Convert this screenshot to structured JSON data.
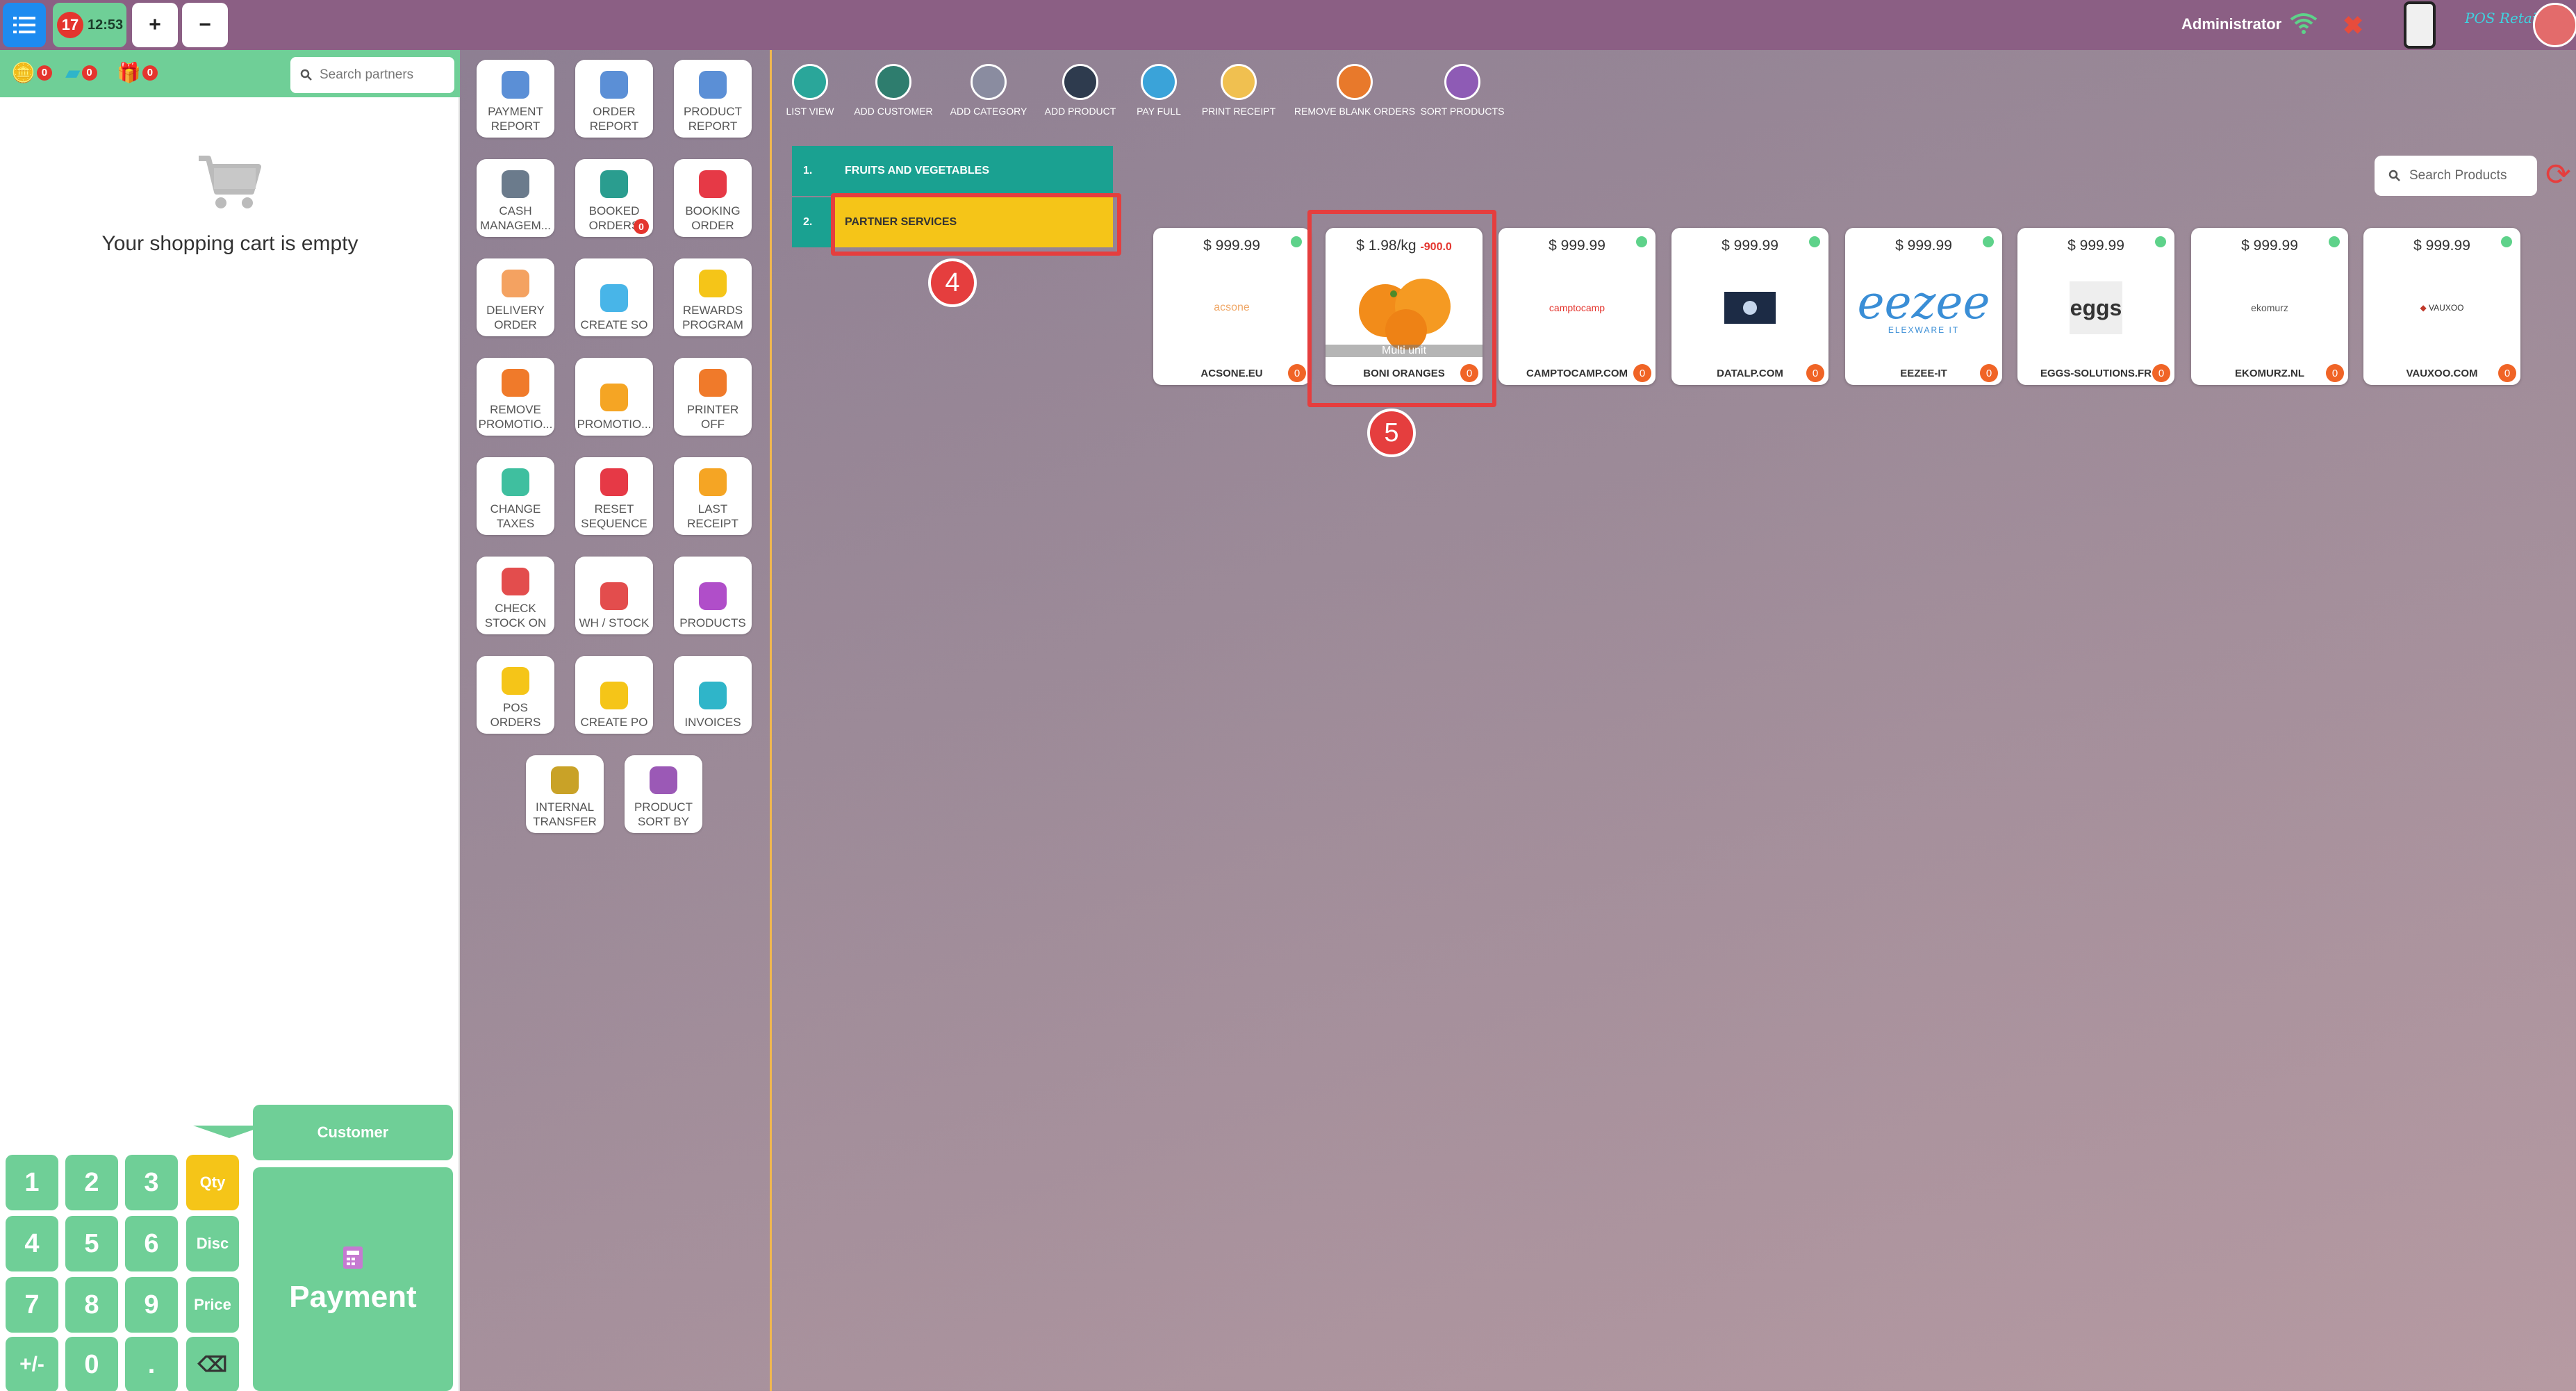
{
  "topbar": {
    "order_badge": "17",
    "order_time": "12:53",
    "plus_label": "+",
    "minus_label": "−",
    "user_name": "Administrator",
    "brand": "POS Retail",
    "status_close": "✖"
  },
  "cart": {
    "counters": [
      "0",
      "0",
      "0"
    ],
    "partner_search_placeholder": "Search partners",
    "empty_message": "Your shopping cart is empty"
  },
  "numpad": {
    "keys": [
      "1",
      "2",
      "3",
      "Qty",
      "4",
      "5",
      "6",
      "Disc",
      "7",
      "8",
      "9",
      "Price",
      "+/-",
      "0",
      ".",
      "⌫"
    ],
    "customer_label": "Customer",
    "payment_label": "Payment"
  },
  "functions": [
    {
      "label": "PAYMENT REPORT",
      "icon": "payment-report-icon",
      "color": "#5b8fd6"
    },
    {
      "label": "ORDER REPORT",
      "icon": "order-report-icon",
      "color": "#5b8fd6"
    },
    {
      "label": "PRODUCT REPORT",
      "icon": "product-report-icon",
      "color": "#5b8fd6"
    },
    {
      "label": "CASH MANAGEM...",
      "icon": "cash-register-icon",
      "color": "#6b7b8c"
    },
    {
      "label": "BOOKED ORDERS",
      "icon": "booked-orders-icon",
      "color": "#2a9d8f",
      "badge": "0"
    },
    {
      "label": "BOOKING ORDER",
      "icon": "booking-order-icon",
      "color": "#e63946"
    },
    {
      "label": "DELIVERY ORDER",
      "icon": "delivery-order-icon",
      "color": "#f4a261"
    },
    {
      "label": "CREATE SO",
      "icon": "create-so-icon",
      "color": "#48b5e8"
    },
    {
      "label": "REWARDS PROGRAM",
      "icon": "rewards-icon",
      "color": "#f5c518"
    },
    {
      "label": "REMOVE PROMOTIO...",
      "icon": "remove-promotion-icon",
      "color": "#f07a2a"
    },
    {
      "label": "PROMOTIO...",
      "icon": "promotion-icon",
      "color": "#f5a524"
    },
    {
      "label": "PRINTER OFF",
      "icon": "printer-off-icon",
      "color": "#f07a2a"
    },
    {
      "label": "CHANGE TAXES",
      "icon": "change-taxes-icon",
      "color": "#3fbf9f"
    },
    {
      "label": "RESET SEQUENCE",
      "icon": "reset-sequence-icon",
      "color": "#e63946"
    },
    {
      "label": "LAST RECEIPT",
      "icon": "last-receipt-icon",
      "color": "#f5a524"
    },
    {
      "label": "CHECK STOCK ON",
      "icon": "check-stock-icon",
      "color": "#e34d4d"
    },
    {
      "label": "WH / STOCK",
      "icon": "warehouse-stock-icon",
      "color": "#e34d4d"
    },
    {
      "label": "PRODUCTS",
      "icon": "barcode-icon",
      "color": "#b04ec9"
    },
    {
      "label": "POS ORDERS",
      "icon": "pos-orders-icon",
      "color": "#f5c518"
    },
    {
      "label": "CREATE PO",
      "icon": "create-po-icon",
      "color": "#f5c518"
    },
    {
      "label": "INVOICES",
      "icon": "invoices-icon",
      "color": "#2fb5c9"
    },
    {
      "label": "INTERNAL TRANSFER",
      "icon": "internal-transfer-icon",
      "color": "#c9a227"
    },
    {
      "label": "PRODUCT SORT BY",
      "icon": "sort-az-icon",
      "color": "#9b59b6"
    }
  ],
  "toolbar": [
    {
      "label": "LIST VIEW",
      "icon": "list-view-icon",
      "color": "#2aa69a"
    },
    {
      "label": "ADD CUSTOMER",
      "icon": "add-customer-icon",
      "color": "#2e7d6e"
    },
    {
      "label": "ADD CATEGORY",
      "icon": "add-category-icon",
      "color": "#8a8ca0"
    },
    {
      "label": "ADD PRODUCT",
      "icon": "add-product-icon",
      "color": "#2e3b4e"
    },
    {
      "label": "PAY FULL",
      "icon": "pay-full-icon",
      "color": "#3aa3d9"
    },
    {
      "label": "PRINT RECEIPT",
      "icon": "print-receipt-icon",
      "color": "#f0c050"
    },
    {
      "label": "REMOVE BLANK ORDERS",
      "icon": "remove-blank-orders-icon",
      "color": "#e8792b"
    },
    {
      "label": "SORT PRODUCTS",
      "icon": "sort-products-icon",
      "color": "#8e5bb5"
    }
  ],
  "categories": [
    {
      "num": "1.",
      "label": "FRUITS AND VEGETABLES",
      "color": "#1aa191"
    },
    {
      "num": "2.",
      "label": "PARTNER SERVICES",
      "color": "#f5c518"
    }
  ],
  "annotations": {
    "cat_callout": "4",
    "product_callout": "5"
  },
  "search_products_placeholder": "Search Products",
  "products": [
    {
      "price": "$ 999.99",
      "name": "ACSONE.EU",
      "logo": "acsone",
      "count": "0"
    },
    {
      "price": "$ 1.98/kg",
      "discount": "-900.0",
      "name": "BONI ORANGES",
      "logo": "oranges",
      "subtitle": "Multi unit",
      "count": "0"
    },
    {
      "price": "$ 999.99",
      "name": "CAMPTOCAMP.COM",
      "logo": "camptocamp",
      "count": "0"
    },
    {
      "price": "$ 999.99",
      "name": "DATALP.COM",
      "logo": "datalp",
      "count": "0"
    },
    {
      "price": "$ 999.99",
      "name": "EEZEE-IT",
      "logo": "eezee",
      "count": "0"
    },
    {
      "price": "$ 999.99",
      "name": "EGGS-SOLUTIONS.FR",
      "logo": "eggs",
      "count": "0"
    },
    {
      "price": "$ 999.99",
      "name": "EKOMURZ.NL",
      "logo": "ekomurz",
      "count": "0"
    },
    {
      "price": "$ 999.99",
      "name": "VAUXOO.COM",
      "logo": "vauxoo",
      "count": "0"
    }
  ],
  "logo_texts": {
    "acsone": "acsone",
    "camptocamp": "camptocamp",
    "eezee": "eezee",
    "eezee_sub": "ELEXWARE IT",
    "eggs": "eggs",
    "ekomurz": "ekomurz",
    "vauxoo": "VAUXOO"
  },
  "colors": {
    "topbar": "#8b5f84",
    "accent_green": "#6fcf97",
    "accent_yellow": "#f5c518",
    "teal": "#1aa191",
    "badge_red": "#e4352e",
    "highlight": "#e53e3e"
  }
}
